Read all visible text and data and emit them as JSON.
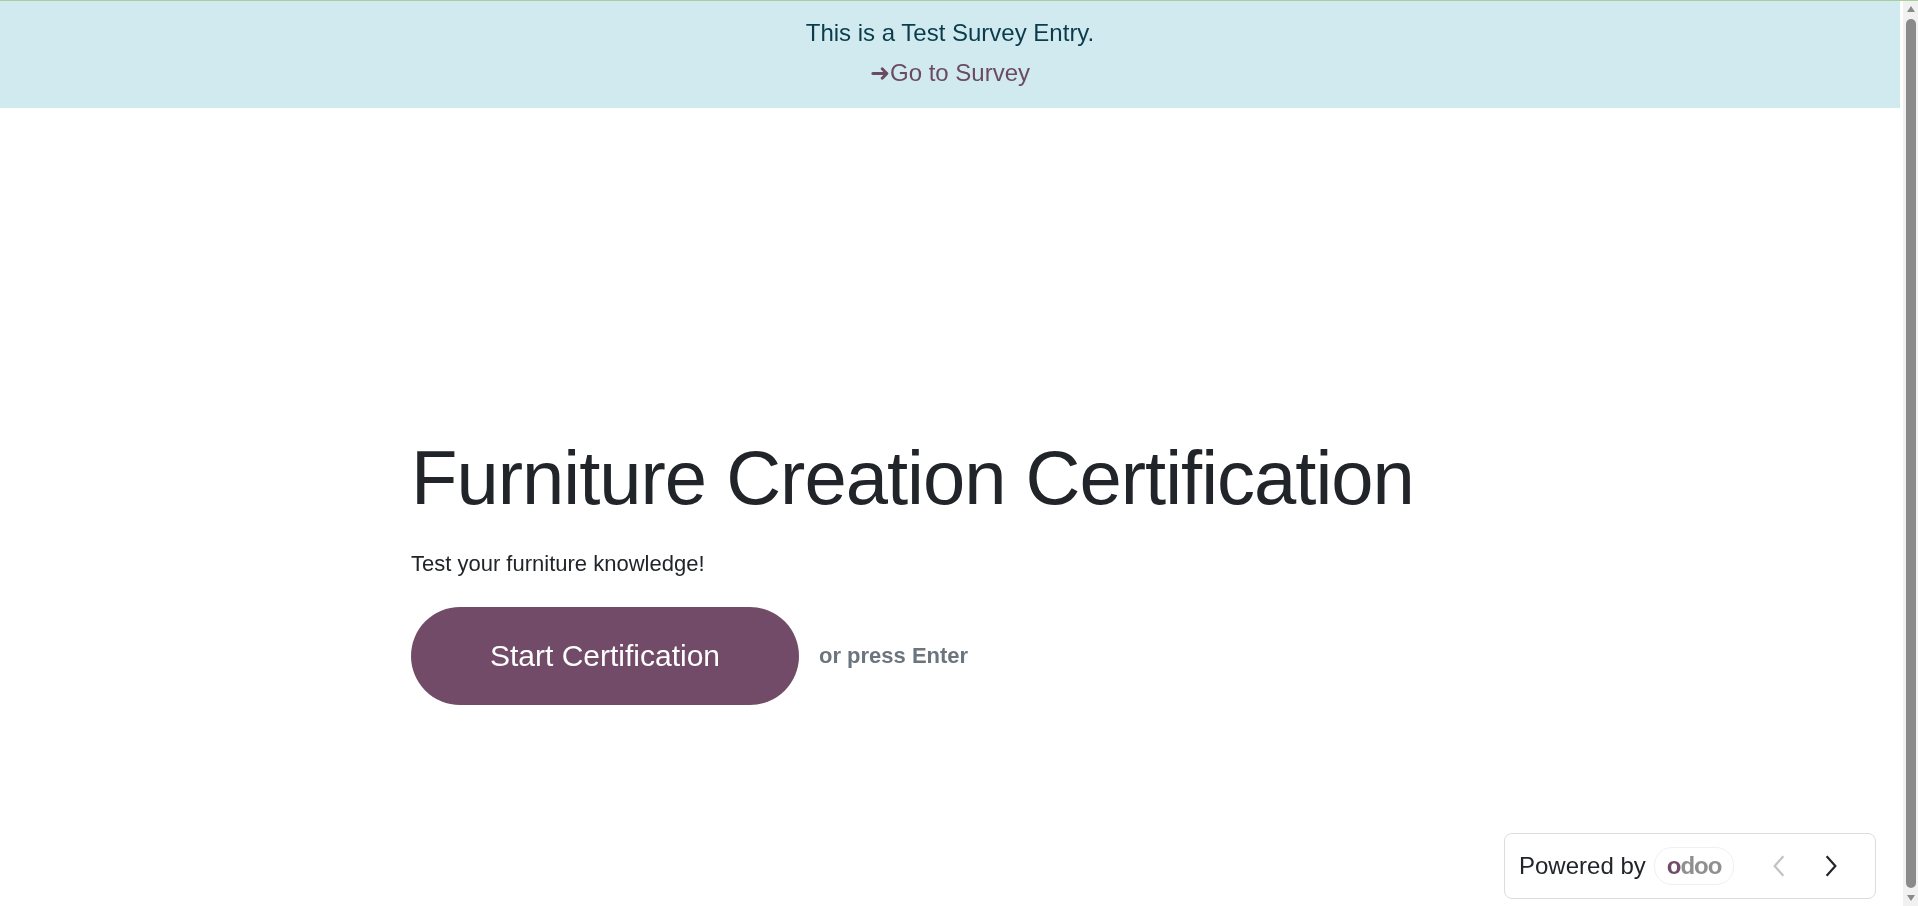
{
  "banner": {
    "message": "This is a Test Survey Entry.",
    "link_arrow": "➜",
    "link": "Go to Survey"
  },
  "survey": {
    "title": "Furniture Creation Certification",
    "description": "Test your furniture knowledge!",
    "start_button": "Start Certification",
    "hint": "or press Enter"
  },
  "footer": {
    "powered_by": "Powered by",
    "logo_text": "odoo",
    "nav": [
      {
        "kind": "prev",
        "disabled": true
      },
      {
        "kind": "next",
        "disabled": false
      }
    ]
  }
}
